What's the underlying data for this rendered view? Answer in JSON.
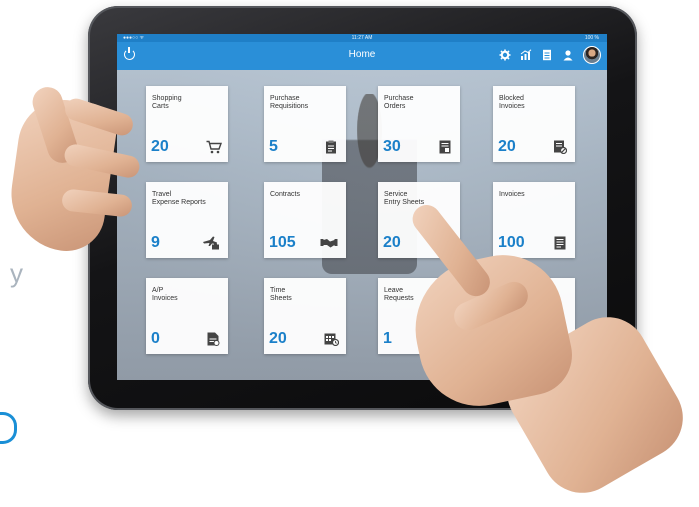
{
  "status_bar": {
    "signal": "●●●○○  ᯤ",
    "time": "11:27 AM",
    "battery": "100 %"
  },
  "app_bar": {
    "title": "Home",
    "icons": [
      "power-icon",
      "gear-icon",
      "analytics-icon",
      "tasks-icon",
      "user-icon"
    ]
  },
  "tiles": [
    {
      "label": "Shopping\nCarts",
      "count": "20",
      "icon": "cart-icon"
    },
    {
      "label": "Purchase\nRequisitions",
      "count": "5",
      "icon": "clipboard-icon"
    },
    {
      "label": "Purchase\nOrders",
      "count": "30",
      "icon": "document-icon"
    },
    {
      "label": "Blocked\nInvoices",
      "count": "20",
      "icon": "blocked-invoice-icon"
    },
    {
      "label": "Travel\nExpense Reports",
      "count": "9",
      "icon": "travel-icon"
    },
    {
      "label": "Contracts",
      "count": "105",
      "icon": "handshake-icon"
    },
    {
      "label": "Service\nEntry Sheets",
      "count": "20",
      "icon": "truck-icon"
    },
    {
      "label": "Invoices",
      "count": "100",
      "icon": "invoice-icon"
    },
    {
      "label": "A/P\nInvoices",
      "count": "0",
      "icon": "ap-invoice-icon"
    },
    {
      "label": "Time\nSheets",
      "count": "20",
      "icon": "calendar-icon"
    },
    {
      "label": "Leave\nRequests",
      "count": "1",
      "icon": "leave-icon"
    }
  ],
  "colors": {
    "accent": "#2a8fd8",
    "count": "#1b80c9"
  }
}
